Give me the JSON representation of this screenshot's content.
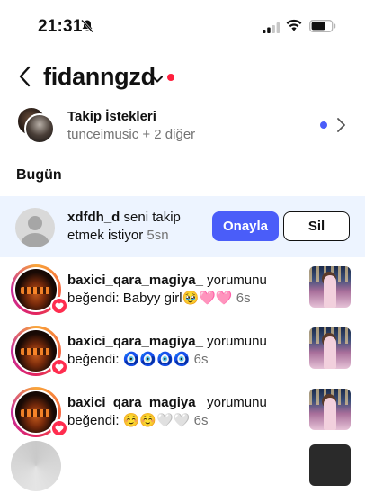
{
  "status_bar": {
    "time": "21:31",
    "icons": [
      "bell-slash-icon",
      "cellular-signal-icon",
      "wifi-icon",
      "battery-icon"
    ]
  },
  "header": {
    "back_icon": "chevron-left-icon",
    "account_name": "fidanngzd",
    "switcher_icon": "chevron-down-icon",
    "notification_dot_color": "#ff1f3d"
  },
  "follow_requests": {
    "title": "Takip İstekleri",
    "subtitle": "tunceimusic + 2 diğer",
    "unread_dot_color": "#4a5df9",
    "chevron_icon": "chevron-right-icon"
  },
  "section": {
    "title": "Bugün"
  },
  "notifications": [
    {
      "username": "xdfdh_d",
      "text": " seni takip etmek istiyor",
      "time": "5sn",
      "approve_label": "Onayla",
      "delete_label": "Sil",
      "highlighted": true
    },
    {
      "username": "baxici_qara_magiya_",
      "text": " yorumunu beğendi: Babyy girl🥹🩷🩷",
      "time": "6s"
    },
    {
      "username": "baxici_qara_magiya_",
      "text": " yorumunu beğendi: 🧿🧿🧿🧿",
      "time": "6s"
    },
    {
      "username": "baxici_qara_magiya_",
      "text": " yorumunu beğendi: ☺️☺️🤍🤍",
      "time": "6s"
    }
  ],
  "colors": {
    "accent": "#4a5df9",
    "highlight_bg": "#edf4ff",
    "like_badge": "#ff2d4f"
  }
}
